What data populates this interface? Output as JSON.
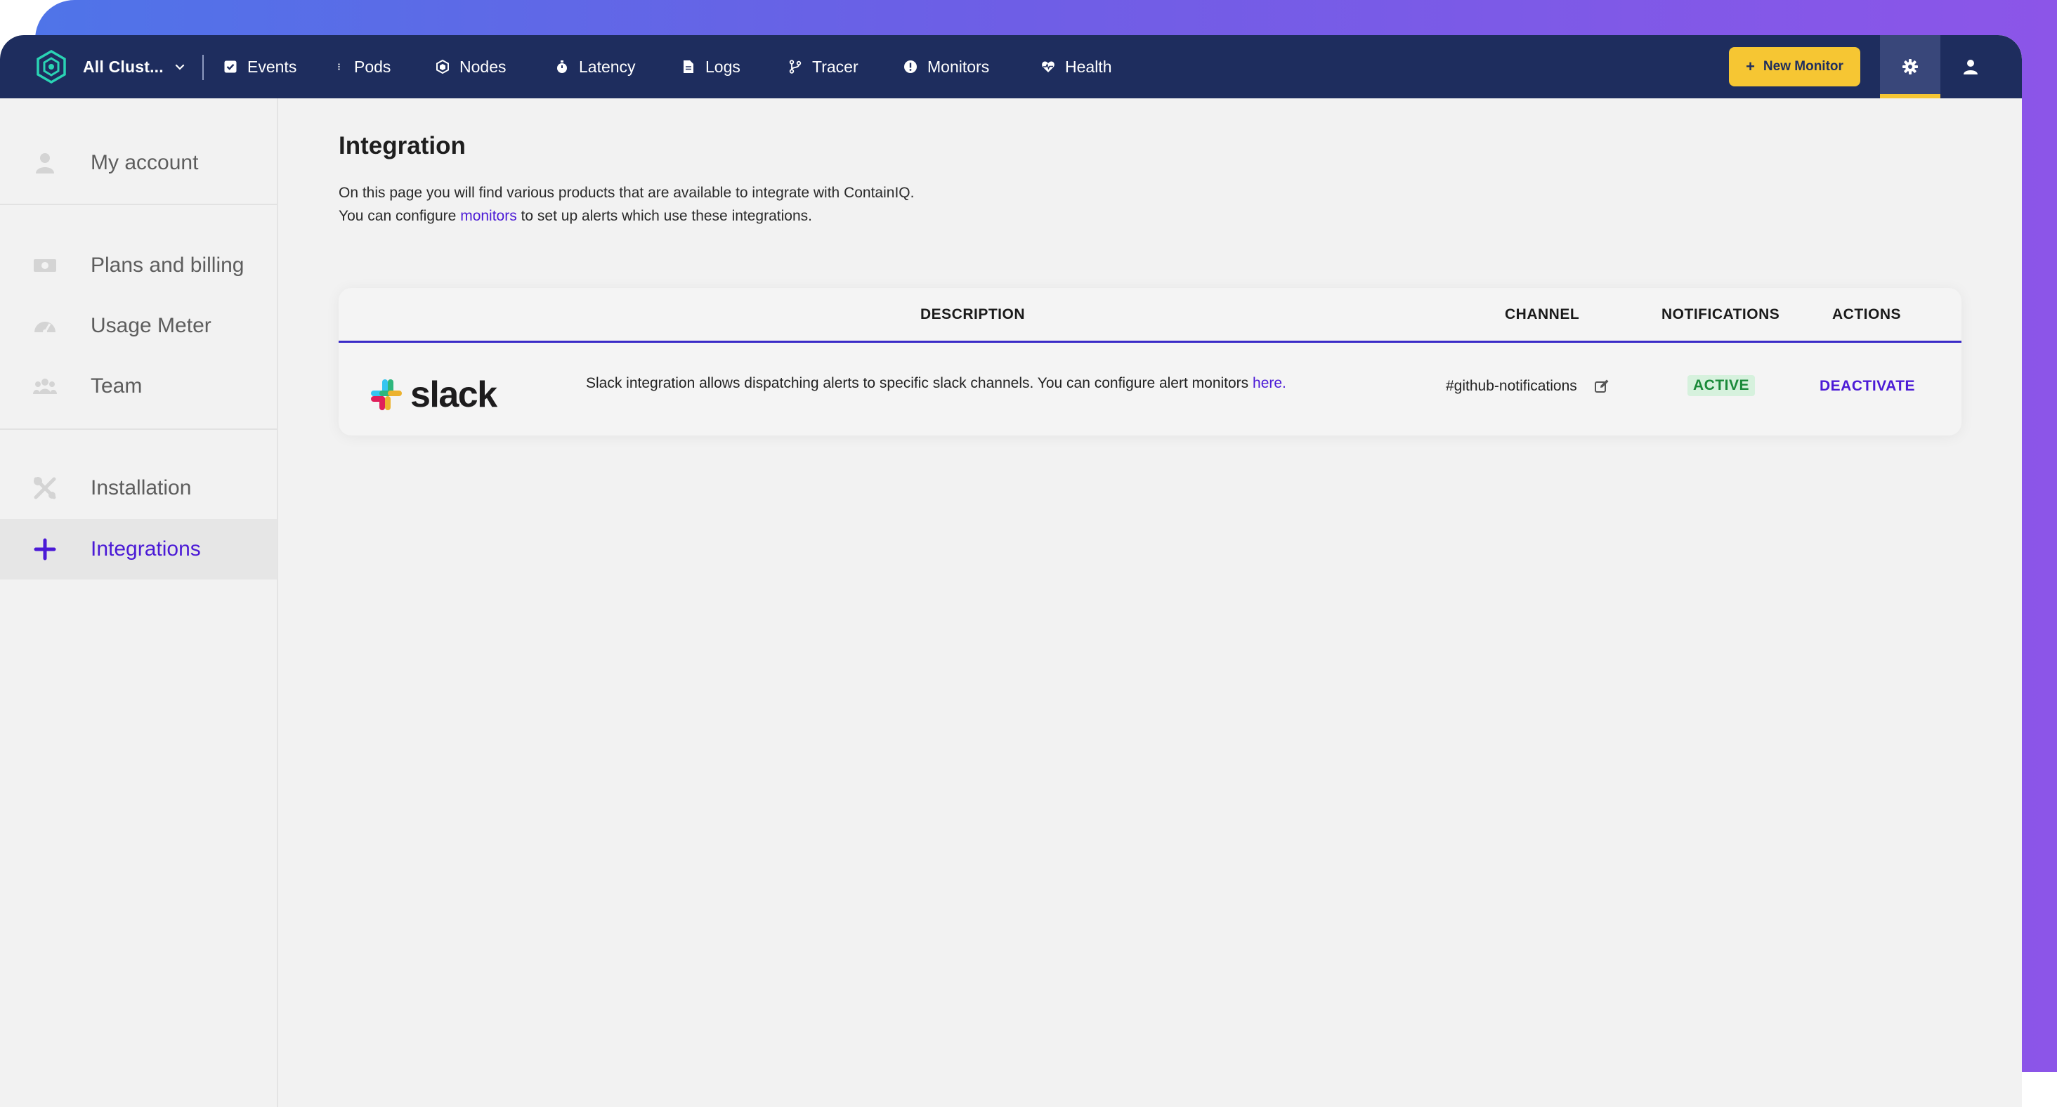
{
  "topbar": {
    "cluster_label": "All Clust...",
    "nav": [
      {
        "label": "Events",
        "icon": "check-square-icon"
      },
      {
        "label": "Pods",
        "icon": "vertical-dots-icon"
      },
      {
        "label": "Nodes",
        "icon": "hexagon-icon"
      },
      {
        "label": "Latency",
        "icon": "stopwatch-icon"
      },
      {
        "label": "Logs",
        "icon": "file-icon"
      },
      {
        "label": "Tracer",
        "icon": "git-branch-icon"
      },
      {
        "label": "Monitors",
        "icon": "alert-circle-icon"
      },
      {
        "label": "Health",
        "icon": "heart-pulse-icon"
      }
    ],
    "new_monitor_label": "New Monitor",
    "accent_color": "#f6c633",
    "bar_color": "#1e2d5e"
  },
  "sidebar": {
    "items": [
      {
        "label": "My account",
        "icon": "user-icon"
      },
      {
        "label": "Plans and billing",
        "icon": "money-bill-icon"
      },
      {
        "label": "Usage Meter",
        "icon": "gauge-icon"
      },
      {
        "label": "Team",
        "icon": "users-icon"
      },
      {
        "label": "Installation",
        "icon": "tools-icon"
      },
      {
        "label": "Integrations",
        "icon": "plus-icon",
        "active": true
      }
    ]
  },
  "main": {
    "title": "Integration",
    "intro_line1": "On this page you will find various products that are available to integrate with ContainIQ.",
    "intro_line2_pre": "You can configure ",
    "intro_line2_link": "monitors",
    "intro_line2_post": " to set up alerts which use these integrations.",
    "table": {
      "headers": {
        "description": "DESCRIPTION",
        "channel": "CHANNEL",
        "notifications": "NOTIFICATIONS",
        "actions": "ACTIONS"
      },
      "rows": [
        {
          "name": "slack",
          "description": "Slack integration allows dispatching alerts to specific slack channels. You can configure alert monitors ",
          "description_link": "here.",
          "channel": "#github-notifications",
          "status": "ACTIVE",
          "action": "DEACTIVATE"
        }
      ]
    }
  }
}
